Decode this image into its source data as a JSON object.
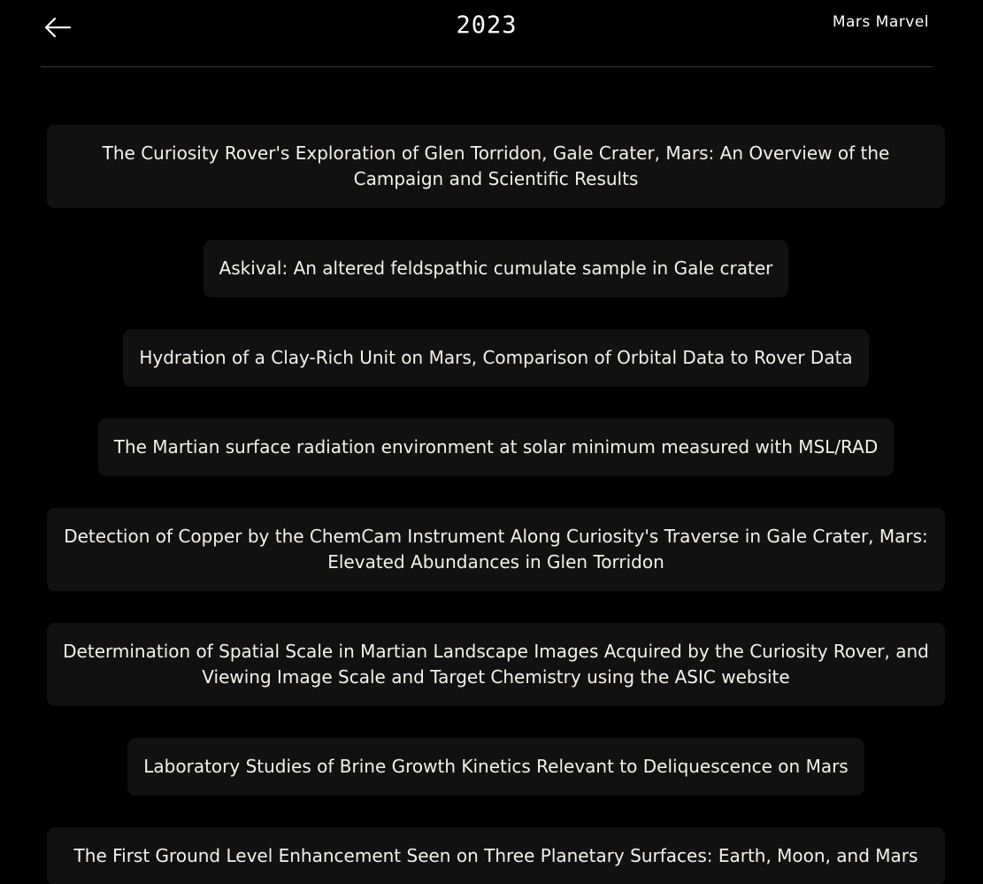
{
  "header": {
    "back_icon": "arrow-left-icon",
    "year": "2023",
    "brand": "Mars Marvel"
  },
  "papers": [
    {
      "title": "The Curiosity Rover's Exploration of Glen Torridon, Gale Crater, Mars: An Overview of the Campaign and Scientific Results"
    },
    {
      "title": "Askival: An altered feldspathic cumulate sample in Gale crater"
    },
    {
      "title": "Hydration of a Clay-Rich Unit on Mars, Comparison of Orbital Data to Rover Data"
    },
    {
      "title": "The Martian surface radiation environment at solar minimum measured with MSL/RAD"
    },
    {
      "title": "Detection of Copper by the ChemCam Instrument Along Curiosity's Traverse in Gale Crater, Mars: Elevated Abundances in Glen Torridon"
    },
    {
      "title": "Determination of Spatial Scale in Martian Landscape Images Acquired by the Curiosity Rover, and Viewing Image Scale and Target Chemistry using the ASIC website"
    },
    {
      "title": "Laboratory Studies of Brine Growth Kinetics Relevant to Deliquescence on Mars"
    },
    {
      "title": "The First Ground Level Enhancement Seen on Three Planetary Surfaces: Earth, Moon, and Mars"
    }
  ]
}
